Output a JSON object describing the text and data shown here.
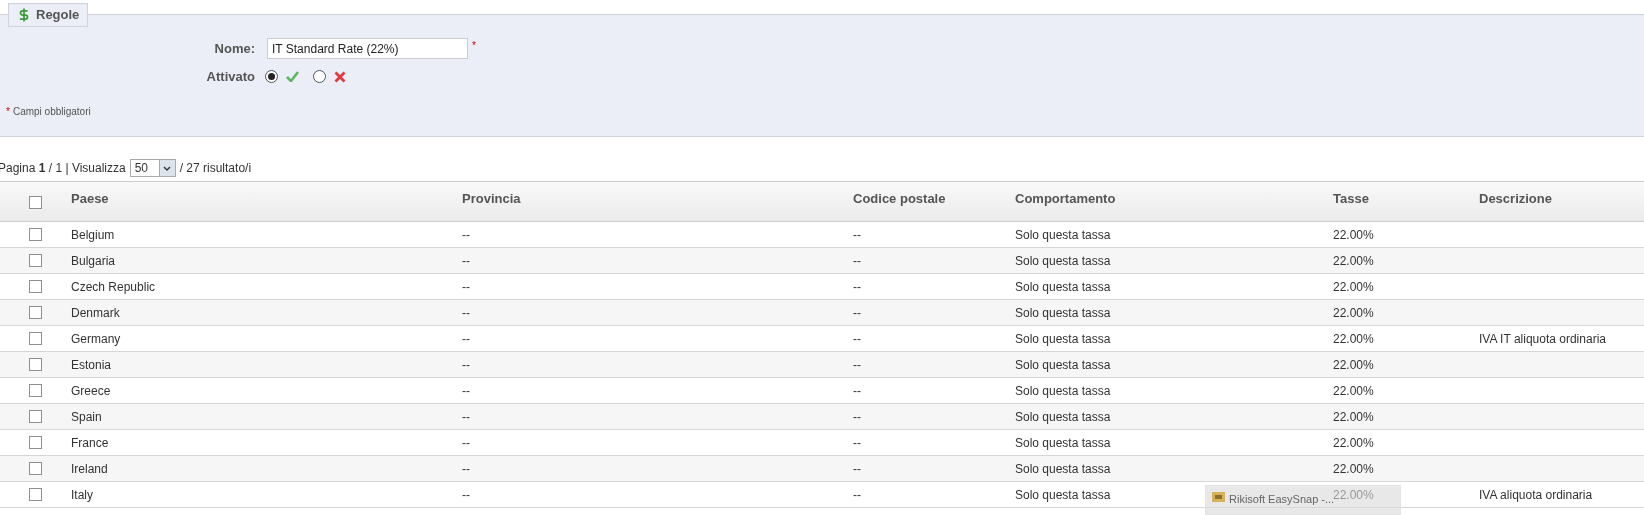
{
  "fieldset": {
    "legend": "Regole",
    "name_label": "Nome:",
    "name_value": "IT Standard Rate (22%)",
    "required_mark": "*",
    "enabled_label": "Attivato",
    "enabled_options": [
      {
        "kind": "yes",
        "selected": true
      },
      {
        "kind": "no",
        "selected": false
      }
    ],
    "required_note_mark": "*",
    "required_note": "Campi obbligatori"
  },
  "pagination": {
    "page_label": "Pagina",
    "page": "1",
    "page_rest": "/ 1 | Visualizza",
    "per_page": "50",
    "results": "/ 27 risultato/i"
  },
  "table": {
    "select_all_checked": false,
    "columns": [
      "Paese",
      "Provincia",
      "Codice postale",
      "Comportamento",
      "Tasse",
      "Descrizione"
    ],
    "rows": [
      {
        "checked": false,
        "cells": [
          "Belgium",
          "--",
          "--",
          "Solo questa tassa",
          "22.00%",
          ""
        ]
      },
      {
        "checked": false,
        "cells": [
          "Bulgaria",
          "--",
          "--",
          "Solo questa tassa",
          "22.00%",
          ""
        ]
      },
      {
        "checked": false,
        "cells": [
          "Czech Republic",
          "--",
          "--",
          "Solo questa tassa",
          "22.00%",
          ""
        ]
      },
      {
        "checked": false,
        "cells": [
          "Denmark",
          "--",
          "--",
          "Solo questa tassa",
          "22.00%",
          ""
        ]
      },
      {
        "checked": false,
        "cells": [
          "Germany",
          "--",
          "--",
          "Solo questa tassa",
          "22.00%",
          "IVA IT aliquota ordinaria"
        ]
      },
      {
        "checked": false,
        "cells": [
          "Estonia",
          "--",
          "--",
          "Solo questa tassa",
          "22.00%",
          ""
        ]
      },
      {
        "checked": false,
        "cells": [
          "Greece",
          "--",
          "--",
          "Solo questa tassa",
          "22.00%",
          ""
        ]
      },
      {
        "checked": false,
        "cells": [
          "Spain",
          "--",
          "--",
          "Solo questa tassa",
          "22.00%",
          ""
        ]
      },
      {
        "checked": false,
        "cells": [
          "France",
          "--",
          "--",
          "Solo questa tassa",
          "22.00%",
          ""
        ]
      },
      {
        "checked": false,
        "cells": [
          "Ireland",
          "--",
          "--",
          "Solo questa tassa",
          "22.00%",
          ""
        ]
      },
      {
        "checked": false,
        "cells": [
          "Italy",
          "--",
          "--",
          "Solo questa tassa",
          "22.00%",
          "IVA aliquota ordinaria"
        ]
      }
    ]
  },
  "taskbar_preview": {
    "title": "Rikisoft EasySnap -..."
  }
}
